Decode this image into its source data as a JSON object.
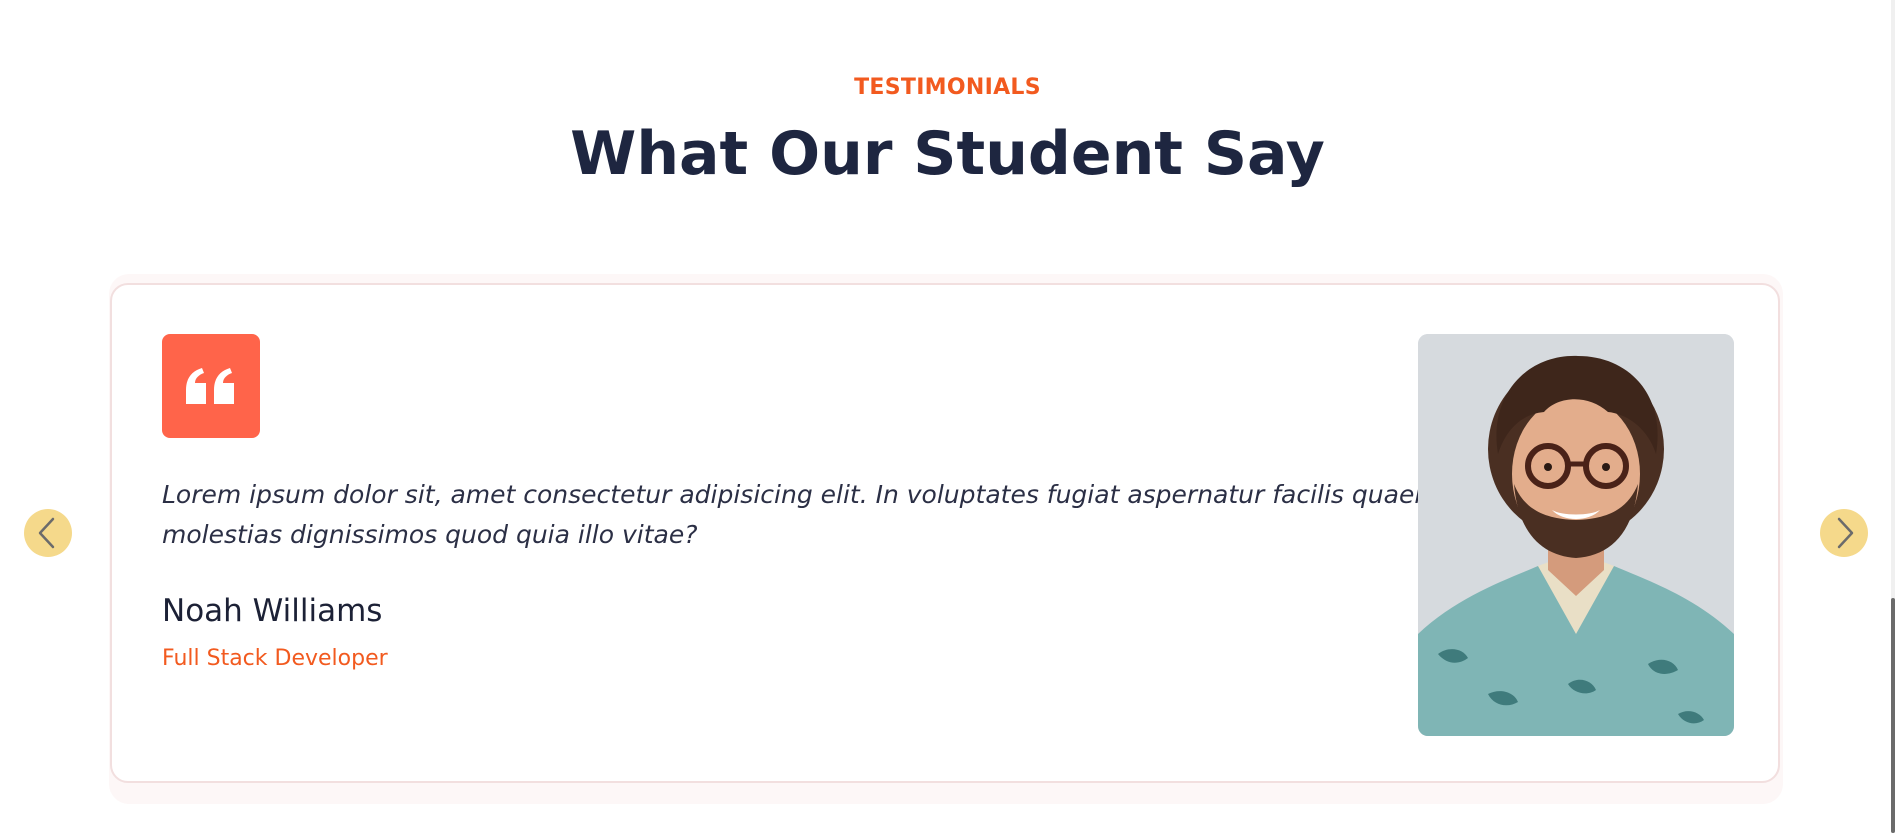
{
  "section": {
    "eyebrow": "TESTIMONIALS",
    "heading": "What Our Student Say"
  },
  "testimonial": {
    "quote": "Lorem ipsum dolor sit, amet consectetur adipisicing elit. In voluptates fugiat aspernatur facilis quaerat molestias dignissimos quod quia illo vitae?",
    "author_name": "Noah Williams",
    "author_role": "Full Stack Developer",
    "photo_icon": "student-photo",
    "quote_icon": "quote-icon"
  },
  "carousel": {
    "prev_icon": "chevron-left-icon",
    "next_icon": "chevron-right-icon"
  },
  "colors": {
    "accent": "#f25a1f",
    "quote_box": "#ff644a",
    "heading": "#1e2640",
    "arrow_bg": "#f5d98b"
  }
}
